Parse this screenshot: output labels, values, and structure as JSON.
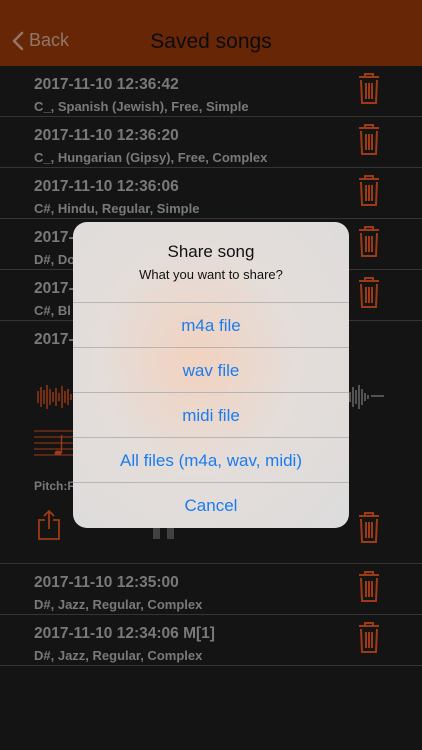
{
  "nav": {
    "back_label": "Back",
    "title": "Saved songs"
  },
  "songs": [
    {
      "date": "2017-11-10 12:36:42",
      "details": "C_, Spanish (Jewish), Free, Simple"
    },
    {
      "date": "2017-11-10 12:36:20",
      "details": "C_, Hungarian (Gipsy), Free, Complex"
    },
    {
      "date": "2017-11-10 12:36:06",
      "details": "C#, Hindu, Regular, Simple"
    },
    {
      "date": "2017-",
      "details": "D#, Do"
    },
    {
      "date": "2017-",
      "details": "C#, Bl"
    }
  ],
  "expanded_song": {
    "date": "2017-",
    "pitch_label": "Pitch:F"
  },
  "songs_after": [
    {
      "date": "2017-11-10 12:35:00",
      "details": "D#, Jazz, Regular, Complex"
    },
    {
      "date": "2017-11-10 12:34:06 M[1]",
      "details": "D#, Jazz, Regular, Complex"
    }
  ],
  "dialog": {
    "title": "Share song",
    "message": "What you want to share?",
    "options": [
      "m4a file",
      "wav file",
      "midi file",
      "All files (m4a, wav, midi)",
      "Cancel"
    ]
  },
  "colors": {
    "navbar": "#8f3509",
    "accent": "#d9531e",
    "link": "#1a7cf0"
  }
}
